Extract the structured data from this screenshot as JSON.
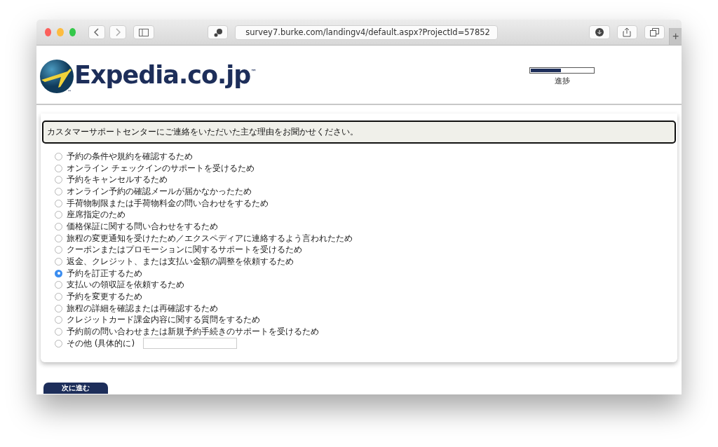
{
  "browser": {
    "url": "survey7.burke.com/landingv4/default.aspx?ProjectId=57852",
    "new_tab": "+"
  },
  "header": {
    "logo_text": "Expedia.co.jp",
    "logo_mark": "™",
    "globe_mark": "™",
    "progress": {
      "level": 0.48,
      "label": "進捗"
    }
  },
  "question": {
    "text": "カスタマーサポートセンターにご連絡をいただいた主な理由をお聞かせください。",
    "options": [
      {
        "kind": "plain",
        "label": "予約の条件や規約を確認するため",
        "selected": false
      },
      {
        "kind": "plain",
        "label": "オンライン チェックインのサポートを受けるため",
        "selected": false
      },
      {
        "kind": "plain",
        "label": "予約をキャンセルするため",
        "selected": false
      },
      {
        "kind": "plain",
        "label": "オンライン予約の確認メールが届かなかったため",
        "selected": false
      },
      {
        "kind": "plain",
        "label": "手荷物制限または手荷物料金の問い合わせをするため",
        "selected": false
      },
      {
        "kind": "plain",
        "label": "座席指定のため",
        "selected": false
      },
      {
        "kind": "plain",
        "label": "価格保証に関する問い合わせをするため",
        "selected": false
      },
      {
        "kind": "plain",
        "label": "旅程の変更通知を受けたため／エクスペディアに連絡するよう言われたため",
        "selected": false
      },
      {
        "kind": "plain",
        "label": "クーポンまたはプロモーションに関するサポートを受けるため",
        "selected": false
      },
      {
        "kind": "plain",
        "label": "返金、クレジット、または支払い金額の調整を依頼するため",
        "selected": false
      },
      {
        "kind": "plain",
        "label": "予約を訂正するため",
        "selected": true
      },
      {
        "kind": "plain",
        "label": "支払いの領収証を依頼するため",
        "selected": false
      },
      {
        "kind": "plain",
        "label": "予約を変更するため",
        "selected": false
      },
      {
        "kind": "plain",
        "label": "旅程の詳細を確認または再確認するため",
        "selected": false
      },
      {
        "kind": "plain",
        "label": "クレジットカード課金内容に関する質問をするため",
        "selected": false
      },
      {
        "kind": "plain",
        "label": "予約前の問い合わせまたは新規予約手続きのサポートを受けるため",
        "selected": false
      },
      {
        "kind": "other",
        "label": "その他 (具体的に)",
        "selected": false
      }
    ]
  },
  "next_button": "次に進む"
}
